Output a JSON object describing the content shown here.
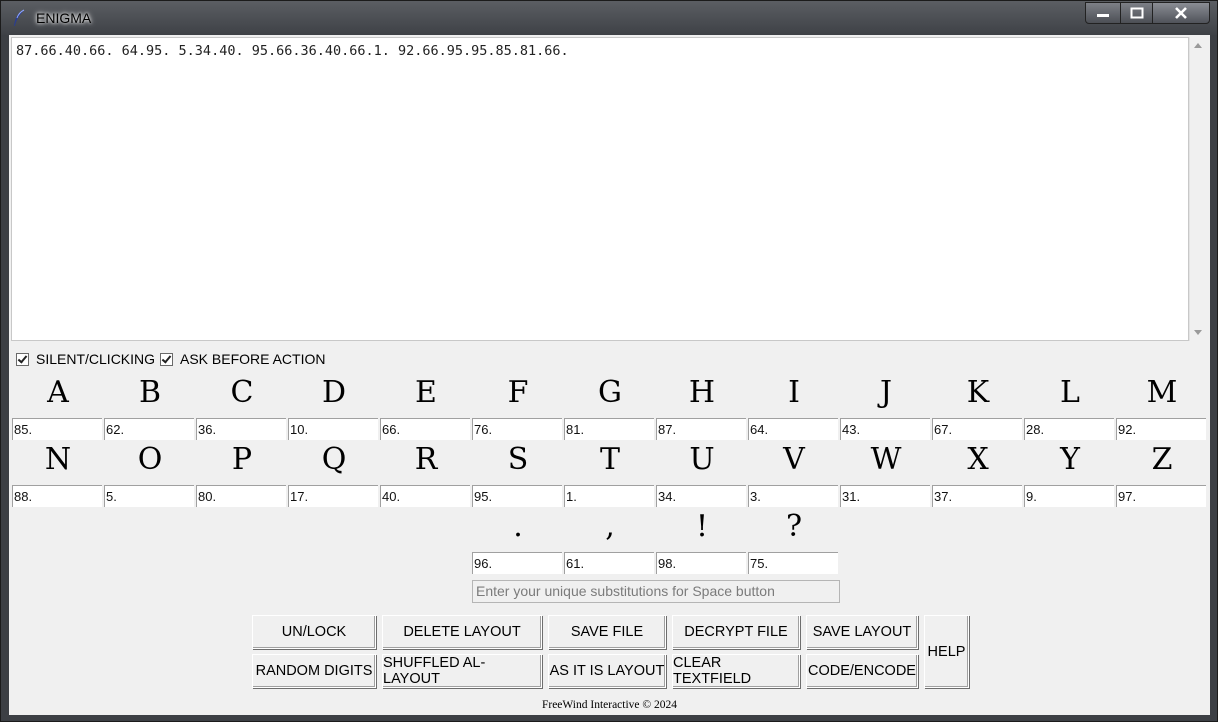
{
  "window": {
    "title": "ENIGMA",
    "icon": "feather-icon",
    "controls": [
      "minimize-icon",
      "maximize-icon",
      "close-icon"
    ]
  },
  "textfield": {
    "content": "87.66.40.66. 64.95. 5.34.40. 95.66.36.40.66.1. 92.66.95.95.85.81.66."
  },
  "options": {
    "silent_label": "SILENT/CLICKING",
    "silent_checked": true,
    "ask_label": "ASK BEFORE ACTION",
    "ask_checked": true
  },
  "row1": {
    "letters": [
      "A",
      "B",
      "C",
      "D",
      "E",
      "F",
      "G",
      "H",
      "I",
      "J",
      "K",
      "L",
      "M"
    ],
    "codes": [
      "85.",
      "62.",
      "36.",
      "10.",
      "66.",
      "76.",
      "81.",
      "87.",
      "64.",
      "43.",
      "67.",
      "28.",
      "92."
    ]
  },
  "row2": {
    "letters": [
      "N",
      "O",
      "P",
      "Q",
      "R",
      "S",
      "T",
      "U",
      "V",
      "W",
      "X",
      "Y",
      "Z"
    ],
    "codes": [
      "88.",
      "5.",
      "80.",
      "17.",
      "40.",
      "95.",
      "1.",
      "34.",
      "3.",
      "31.",
      "37.",
      "9.",
      "97."
    ]
  },
  "punct": {
    "symbols": [
      ".",
      ",",
      "!",
      "?"
    ],
    "codes": [
      "96.",
      "61.",
      "98.",
      "75."
    ]
  },
  "space_field": {
    "placeholder": "Enter your unique substitutions for Space button"
  },
  "buttons": {
    "unlock": "UN/LOCK",
    "delete_layout": "DELETE LAYOUT",
    "save_file": "SAVE FILE",
    "decrypt_file": "DECRYPT FILE",
    "save_layout": "SAVE LAYOUT",
    "help": "HELP",
    "random_digits": "RANDOM DIGITS",
    "shuffled": "SHUFFLED AL-LAYOUT",
    "as_it_is": "AS IT IS LAYOUT",
    "clear_textfield": "CLEAR TEXTFIELD",
    "code_encode": "CODE/ENCODE"
  },
  "footer": "FreeWind Interactive © 2024"
}
